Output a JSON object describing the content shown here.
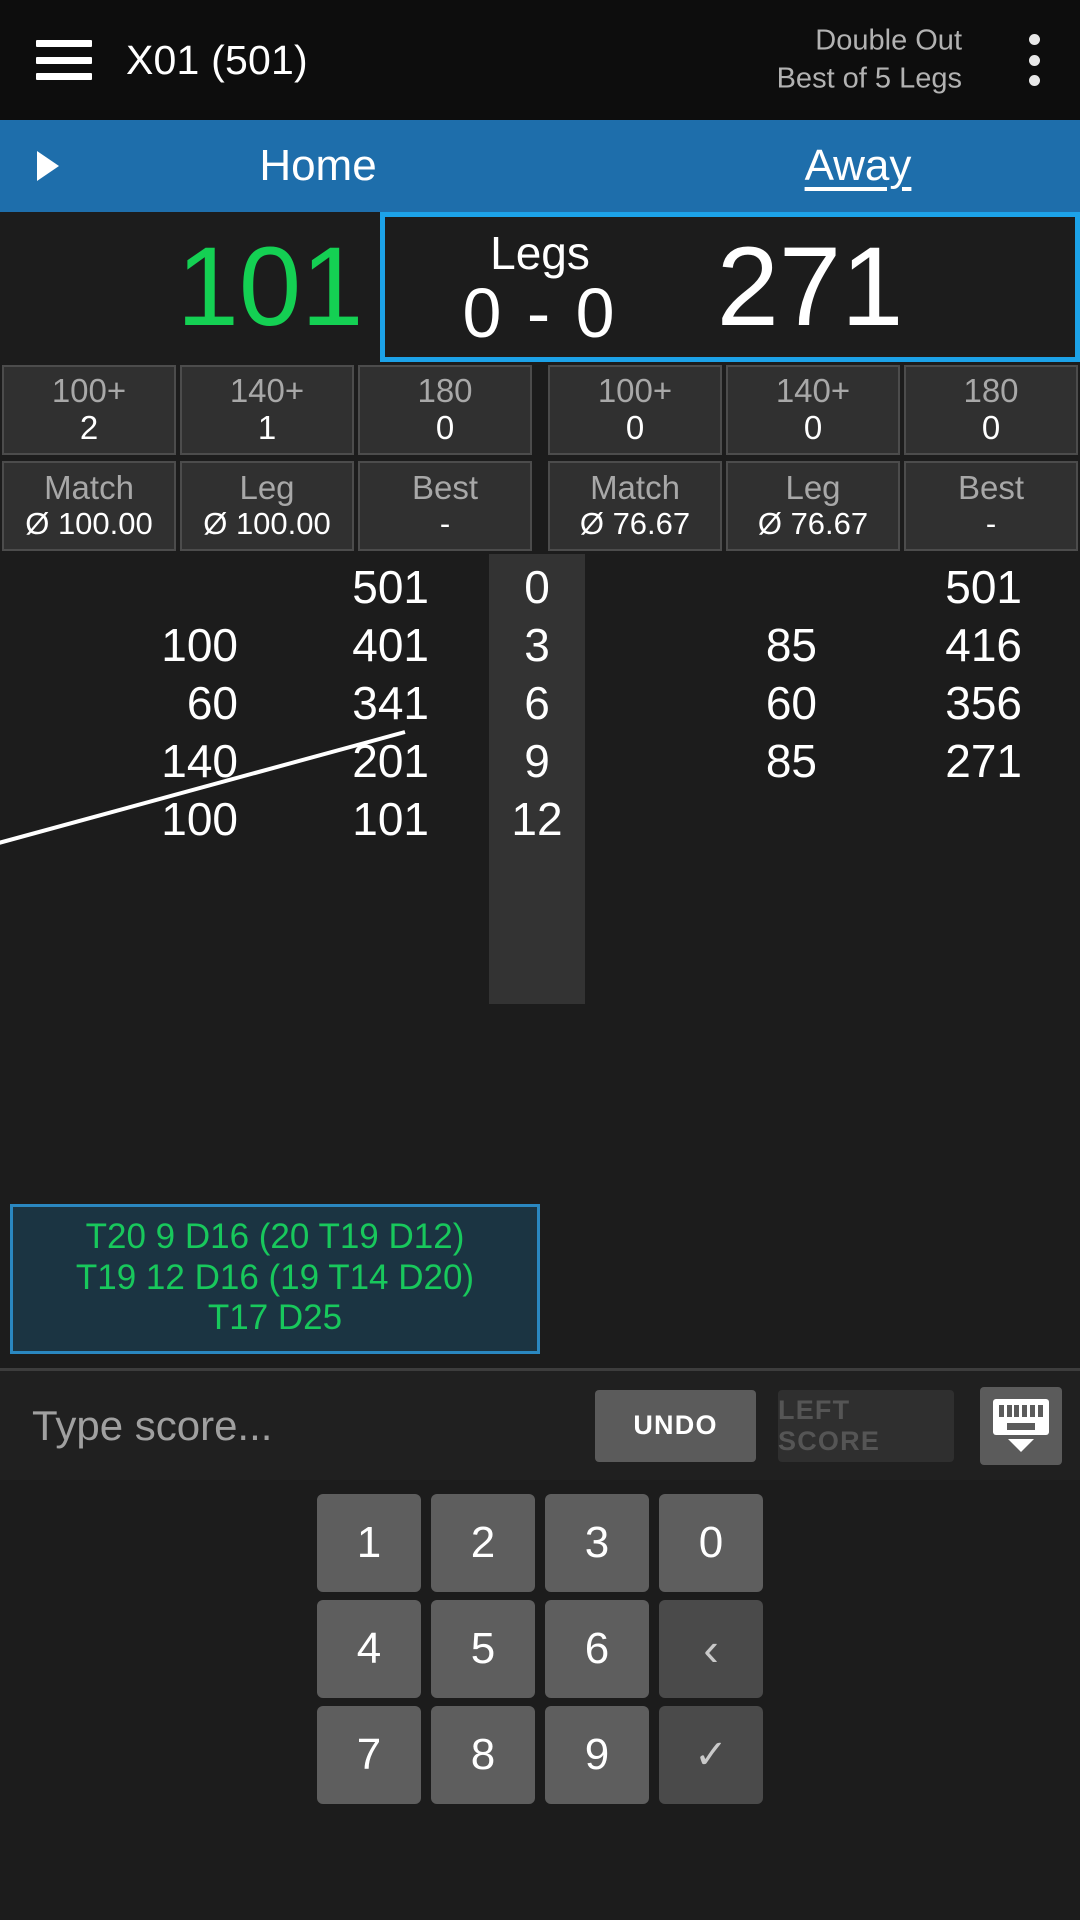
{
  "appbar": {
    "menu_icon": "hamburger-menu-icon",
    "title": "X01 (501)",
    "mode_line1": "Double Out",
    "mode_line2": "Best of 5 Legs",
    "overflow_icon": "more-vertical-icon"
  },
  "tabs": {
    "arrow_icon": "play-arrow-icon",
    "home_label": "Home",
    "away_label": "Away",
    "active": "Away"
  },
  "score": {
    "home_remaining": "101",
    "away_remaining": "271",
    "legs_label": "Legs",
    "legs_value": "0 - 0",
    "home_color": "#14d053",
    "away_color": "#ffffff",
    "highlight_color": "#1ca2e8"
  },
  "stats": {
    "home_counts": [
      {
        "label": "100+",
        "value": "2"
      },
      {
        "label": "140+",
        "value": "1"
      },
      {
        "label": "180",
        "value": "0"
      }
    ],
    "away_counts": [
      {
        "label": "100+",
        "value": "0"
      },
      {
        "label": "140+",
        "value": "0"
      },
      {
        "label": "180",
        "value": "0"
      }
    ],
    "home_averages": [
      {
        "label": "Match",
        "value": "Ø 100.00"
      },
      {
        "label": "Leg",
        "value": "Ø 100.00"
      },
      {
        "label": "Best",
        "value": "-"
      }
    ],
    "away_averages": [
      {
        "label": "Match",
        "value": "Ø 76.67"
      },
      {
        "label": "Leg",
        "value": "Ø 76.67"
      },
      {
        "label": "Best",
        "value": "-"
      }
    ]
  },
  "board": {
    "rows": [
      {
        "home_score": "",
        "home_rem": "501",
        "darts": "0",
        "away_score": "",
        "away_rem": "501"
      },
      {
        "home_score": "100",
        "home_rem": "401",
        "darts": "3",
        "away_score": "85",
        "away_rem": "416"
      },
      {
        "home_score": "60",
        "home_rem": "341",
        "darts": "6",
        "away_score": "60",
        "away_rem": "356"
      },
      {
        "home_score": "140",
        "home_rem": "201",
        "darts": "9",
        "away_score": "85",
        "away_rem": "271"
      },
      {
        "home_score": "100",
        "home_rem": "101",
        "darts": "12",
        "away_score": "",
        "away_rem": ""
      }
    ]
  },
  "checkout": {
    "line1": "T20 9 D16 (20 T19 D12)",
    "line2": "T19 12 D16 (19 T14 D20)",
    "line3": "T17 D25",
    "text_color": "#18c85c",
    "border_color": "#2a87c0"
  },
  "input": {
    "placeholder": "Type score...",
    "value": "",
    "undo_label": "UNDO",
    "left_score_label": "LEFT SCORE",
    "left_score_enabled": false,
    "keyboard_icon": "hide-keyboard-icon"
  },
  "keypad": {
    "rows": [
      [
        {
          "label": "1",
          "name": "key-1",
          "style": "num"
        },
        {
          "label": "2",
          "name": "key-2",
          "style": "num"
        },
        {
          "label": "3",
          "name": "key-3",
          "style": "num"
        },
        {
          "label": "0",
          "name": "key-0",
          "style": "num"
        }
      ],
      [
        {
          "label": "4",
          "name": "key-4",
          "style": "num"
        },
        {
          "label": "5",
          "name": "key-5",
          "style": "num"
        },
        {
          "label": "6",
          "name": "key-6",
          "style": "num"
        },
        {
          "label": "‹",
          "name": "key-backspace",
          "style": "dim"
        }
      ],
      [
        {
          "label": "7",
          "name": "key-7",
          "style": "num"
        },
        {
          "label": "8",
          "name": "key-8",
          "style": "num"
        },
        {
          "label": "9",
          "name": "key-9",
          "style": "num"
        },
        {
          "label": "✓",
          "name": "key-enter",
          "style": "dim"
        }
      ]
    ]
  }
}
